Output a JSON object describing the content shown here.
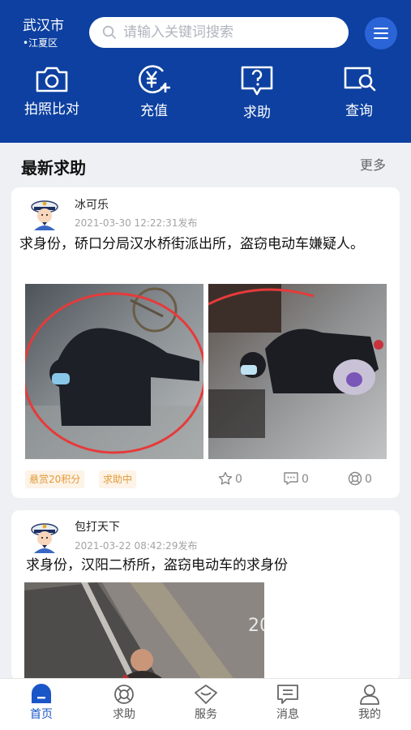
{
  "header": {
    "city": "武汉市",
    "district": "•江夏区",
    "search_placeholder": "请输入关键词搜索"
  },
  "quick_actions": [
    {
      "label": "拍照比对",
      "icon": "camera-icon"
    },
    {
      "label": "充值",
      "icon": "yuan-plus-icon"
    },
    {
      "label": "求助",
      "icon": "question-bubble-icon"
    },
    {
      "label": "查询",
      "icon": "search-card-icon"
    }
  ],
  "section": {
    "title": "最新求助",
    "more": "更多"
  },
  "posts": [
    {
      "username": "冰可乐",
      "time": "2021-03-30 12:22:31发布",
      "text": "求身份，硚口分局汉水桥街派出所，盗窃电动车嫌疑人。",
      "reward_badge": "悬赏20积分",
      "status_badge": "求助中",
      "likes": "0",
      "comments": "0",
      "helps": "0"
    },
    {
      "username": "包打天下",
      "time": "2021-03-22 08:42:29发布",
      "text": "求身份，汉阳二桥所，盗窃电动车的求身份",
      "photo_overlay_text": "20"
    }
  ],
  "tabbar": [
    {
      "label": "首页",
      "icon": "home-icon",
      "active": true
    },
    {
      "label": "求助",
      "icon": "lifebuoy-icon",
      "active": false
    },
    {
      "label": "服务",
      "icon": "heart-diamond-icon",
      "active": false
    },
    {
      "label": "消息",
      "icon": "message-icon",
      "active": false
    },
    {
      "label": "我的",
      "icon": "user-icon",
      "active": false
    }
  ],
  "colors": {
    "header": "#0d40a0",
    "active_tab": "#1a56c8",
    "badge_text": "#e29a3a"
  }
}
